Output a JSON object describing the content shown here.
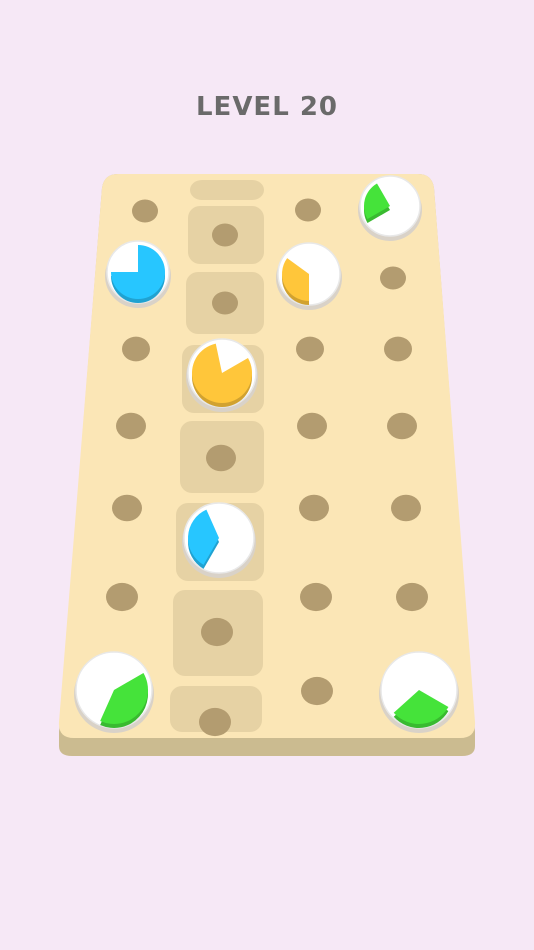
{
  "level": {
    "title": "LEVEL 20"
  },
  "colors": {
    "background": "#f6e8f6",
    "board_top": "#fbe6b6",
    "board_edge": "#c9b98e",
    "channel": "#e6d2a4",
    "hole": "#b39c70",
    "plate": "#ffffff",
    "blue": "#27c6ff",
    "orange": "#ffc63a",
    "green": "#45e33a"
  },
  "pieces": [
    {
      "name": "green-piece-top-right",
      "color": "green",
      "fill_fraction": 0.25
    },
    {
      "name": "blue-piece-upper-left",
      "color": "blue",
      "fill_fraction": 0.75
    },
    {
      "name": "orange-piece-upper",
      "color": "orange",
      "fill_fraction": 0.35
    },
    {
      "name": "orange-piece-center",
      "color": "orange",
      "fill_fraction": 0.8
    },
    {
      "name": "blue-piece-center",
      "color": "blue",
      "fill_fraction": 0.35
    },
    {
      "name": "green-piece-bottom-left",
      "color": "green",
      "fill_fraction": 0.4
    },
    {
      "name": "green-piece-bottom-right",
      "color": "green",
      "fill_fraction": 0.3
    }
  ]
}
